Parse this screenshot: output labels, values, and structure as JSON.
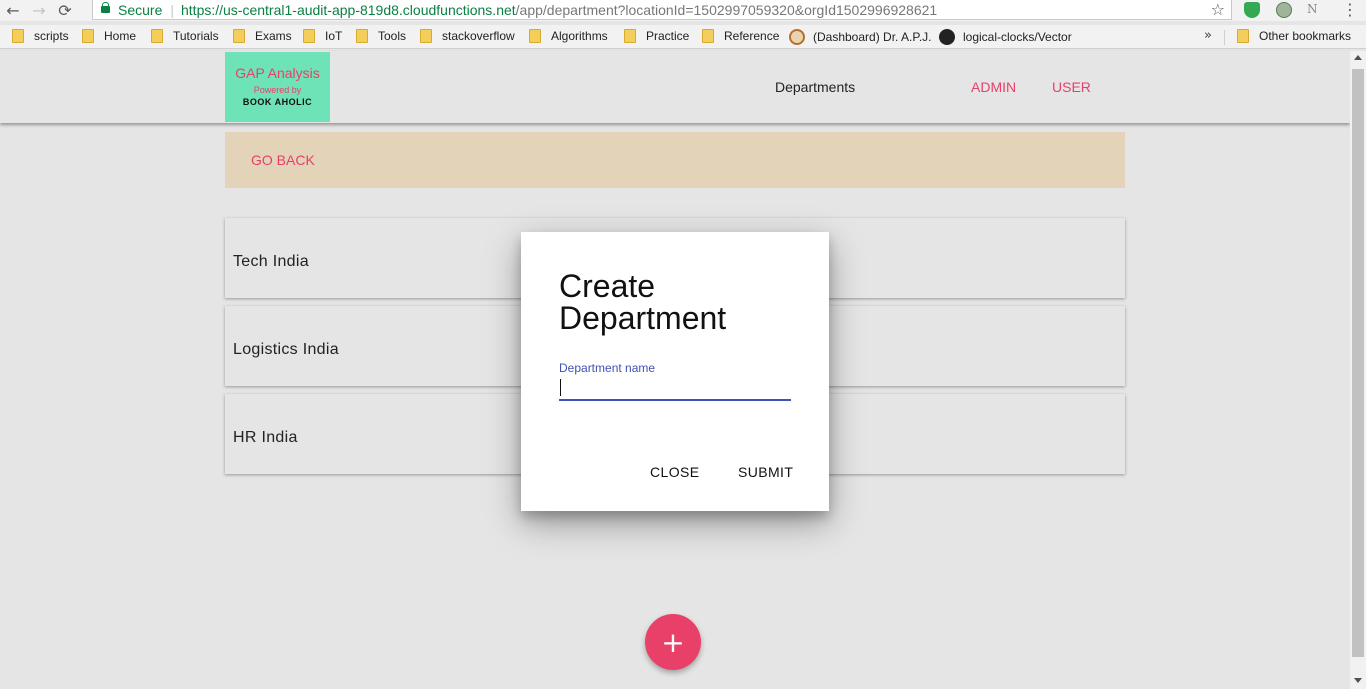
{
  "browser": {
    "secure_label": "Secure",
    "url_main": "https://us-central1-audit-app-819d8.cloudfunctions.net",
    "url_rest": "/app/department?locationId=1502997059320&orgId1502996928621"
  },
  "bookmarks": {
    "items": [
      {
        "label": "scripts"
      },
      {
        "label": "Home"
      },
      {
        "label": "Tutorials"
      },
      {
        "label": "Exams"
      },
      {
        "label": "IoT"
      },
      {
        "label": "Tools"
      },
      {
        "label": "stackoverflow"
      },
      {
        "label": "Algorithms"
      },
      {
        "label": "Practice"
      },
      {
        "label": "Reference"
      },
      {
        "label": "(Dashboard) Dr. A.P.J."
      },
      {
        "label": "logical-clocks/Vector"
      }
    ],
    "other": "Other bookmarks"
  },
  "header": {
    "logo_title": "GAP Analysis",
    "logo_powered": "Powered by",
    "logo_brand": "BOOK AHOLIC",
    "nav_departments": "Departments",
    "nav_admin": "ADMIN",
    "nav_user": "USER"
  },
  "goback": {
    "label": "GO BACK"
  },
  "departments": [
    {
      "name": "Tech India"
    },
    {
      "name": "Logistics India"
    },
    {
      "name": "HR India"
    }
  ],
  "dialog": {
    "title": "Create Department",
    "field_label": "Department name",
    "field_value": "",
    "close_label": "CLOSE",
    "submit_label": "SUBMIT"
  },
  "fab": {
    "icon": "plus-icon",
    "glyph": "+"
  },
  "colors": {
    "accent": "#e9406a",
    "primary": "#3f51b5",
    "logo_bg": "#6de3b7",
    "goback_bg": "#e3d3b9"
  }
}
